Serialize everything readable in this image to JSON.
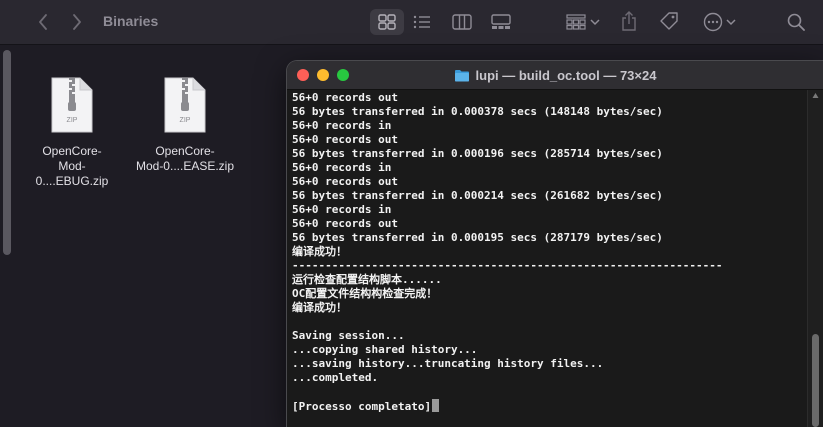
{
  "finder": {
    "title": "Binaries",
    "files": [
      {
        "name_line1": "OpenCore-",
        "name_line2": "Mod-0....EBUG.zip",
        "badge": "ZIP"
      },
      {
        "name_line1": "OpenCore-",
        "name_line2": "Mod-0....EASE.zip",
        "badge": "ZIP"
      }
    ]
  },
  "terminal": {
    "title": "lupi — build_oc.tool — 73×24",
    "lines": [
      "56+0 records out",
      "56 bytes transferred in 0.000378 secs (148148 bytes/sec)",
      "56+0 records in",
      "56+0 records out",
      "56 bytes transferred in 0.000196 secs (285714 bytes/sec)",
      "56+0 records in",
      "56+0 records out",
      "56 bytes transferred in 0.000214 secs (261682 bytes/sec)",
      "56+0 records in",
      "56+0 records out",
      "56 bytes transferred in 0.000195 secs (287179 bytes/sec)",
      "编译成功！",
      "-----------------------------------------------------------------",
      "运行检查配置结构脚本......",
      "OC配置文件结构构检查完成！",
      "编译成功！",
      "",
      "Saving session...",
      "...copying shared history...",
      "...saving history...truncating history files...",
      "...completed.",
      "",
      "[Processo completato]"
    ]
  },
  "colors": {
    "close": "#fe5f57",
    "minimize": "#febc2e",
    "maximize": "#28c840",
    "folder": "#3a9ad9"
  }
}
